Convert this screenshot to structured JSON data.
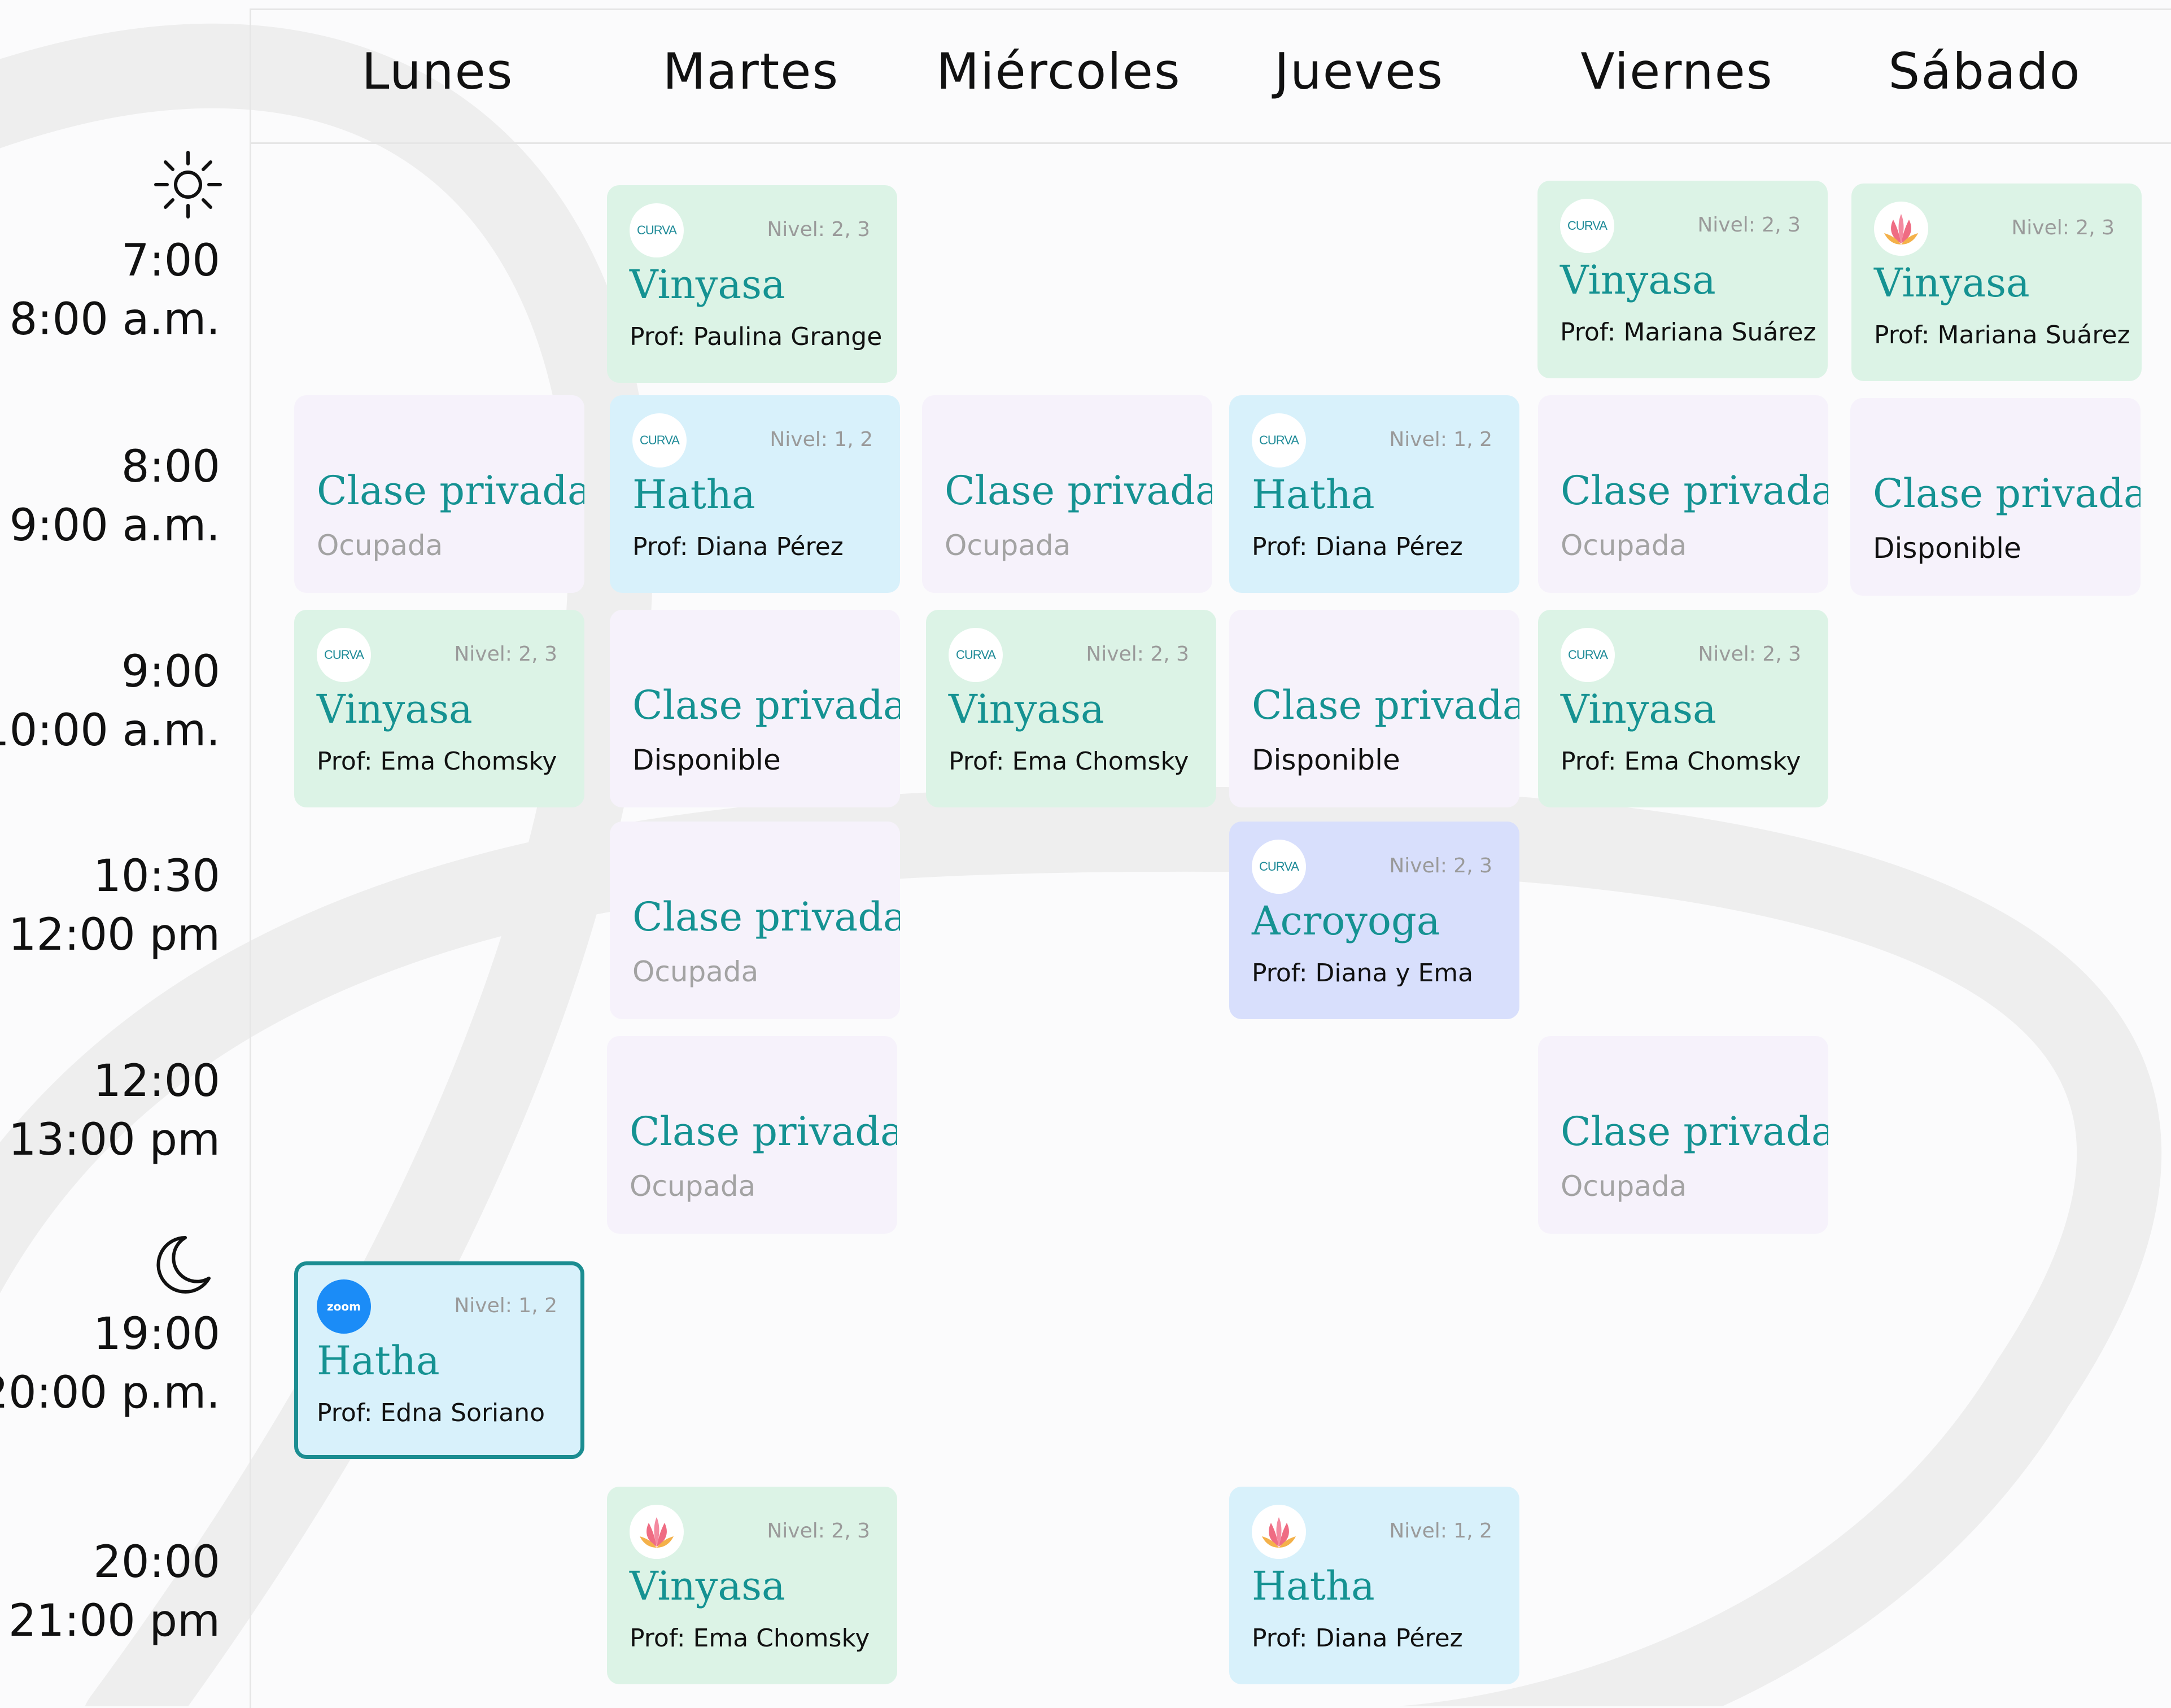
{
  "days": [
    "Lunes",
    "Martes",
    "Miércoles",
    "Jueves",
    "Viernes",
    "Sábado"
  ],
  "icons": {
    "morning": "sun-icon",
    "evening": "moon-icon"
  },
  "times": [
    {
      "start": "7:00",
      "end": "8:00 a.m."
    },
    {
      "start": "8:00",
      "end": "9:00 a.m."
    },
    {
      "start": "9:00",
      "end": "10:00 a.m."
    },
    {
      "start": "10:30",
      "end": "12:00 pm"
    },
    {
      "start": "12:00",
      "end": "13:00 pm"
    },
    {
      "start": "19:00",
      "end": "20:00 p.m."
    },
    {
      "start": "20:00",
      "end": "21:00 pm"
    }
  ],
  "cards": [
    {
      "day": "Martes",
      "slot": "7:00",
      "logo": "curva-logo",
      "level": "Nivel: 2, 3",
      "title": "Vinyasa",
      "prof": "Prof: Paulina Grange"
    },
    {
      "day": "Viernes",
      "slot": "7:00",
      "logo": "curva-logo",
      "level": "Nivel: 2, 3",
      "title": "Vinyasa",
      "prof": "Prof: Mariana Suárez"
    },
    {
      "day": "Sábado",
      "slot": "7:00",
      "logo": "lotus-logo",
      "level": "Nivel: 2, 3",
      "title": "Vinyasa",
      "prof": "Prof: Mariana Suárez"
    },
    {
      "day": "Lunes",
      "slot": "8:00",
      "title": "Clase privada",
      "status": "Ocupada"
    },
    {
      "day": "Martes",
      "slot": "8:00",
      "logo": "curva-logo",
      "level": "Nivel: 1, 2",
      "title": "Hatha",
      "prof": "Prof: Diana Pérez"
    },
    {
      "day": "Miércoles",
      "slot": "8:00",
      "title": "Clase privada",
      "status": "Ocupada"
    },
    {
      "day": "Jueves",
      "slot": "8:00",
      "logo": "curva-logo",
      "level": "Nivel: 1, 2",
      "title": "Hatha",
      "prof": "Prof: Diana Pérez"
    },
    {
      "day": "Viernes",
      "slot": "8:00",
      "title": "Clase privada",
      "status": "Ocupada"
    },
    {
      "day": "Sábado",
      "slot": "8:00",
      "title": "Clase privada",
      "status": "Disponible"
    },
    {
      "day": "Lunes",
      "slot": "9:00",
      "logo": "curva-logo",
      "level": "Nivel: 2, 3",
      "title": "Vinyasa",
      "prof": "Prof: Ema Chomsky"
    },
    {
      "day": "Martes",
      "slot": "9:00",
      "title": "Clase privada",
      "status": "Disponible"
    },
    {
      "day": "Miércoles",
      "slot": "9:00",
      "logo": "curva-logo",
      "level": "Nivel: 2, 3",
      "title": "Vinyasa",
      "prof": "Prof: Ema Chomsky"
    },
    {
      "day": "Jueves",
      "slot": "9:00",
      "title": "Clase privada",
      "status": "Disponible"
    },
    {
      "day": "Viernes",
      "slot": "9:00",
      "logo": "curva-logo",
      "level": "Nivel: 2, 3",
      "title": "Vinyasa",
      "prof": "Prof: Ema Chomsky"
    },
    {
      "day": "Martes",
      "slot": "10:30",
      "title": "Clase privada",
      "status": "Ocupada"
    },
    {
      "day": "Jueves",
      "slot": "10:30",
      "logo": "curva-logo",
      "level": "Nivel: 2, 3",
      "title": "Acroyoga",
      "prof": "Prof: Diana y Ema"
    },
    {
      "day": "Martes",
      "slot": "12:00",
      "title": "Clase privada",
      "status": "Ocupada"
    },
    {
      "day": "Viernes",
      "slot": "12:00",
      "title": "Clase privada",
      "status": "Ocupada"
    },
    {
      "day": "Lunes",
      "slot": "19:00",
      "logo": "zoom-logo",
      "level": "Nivel: 1, 2",
      "title": "Hatha",
      "prof": "Prof: Edna Soriano"
    },
    {
      "day": "Martes",
      "slot": "20:00",
      "logo": "lotus-logo",
      "level": "Nivel: 2, 3",
      "title": "Vinyasa",
      "prof": "Prof: Ema Chomsky"
    },
    {
      "day": "Jueves",
      "slot": "20:00",
      "logo": "lotus-logo",
      "level": "Nivel: 1, 2",
      "title": "Hatha",
      "prof": "Prof: Diana Pérez"
    }
  ],
  "logos": {
    "curva": "CURVA",
    "zoom": "zoom"
  },
  "colors": {
    "title_teal": "#159292",
    "vinyasa_green": "#dcf3e6",
    "hatha_blue": "#d8f1fb",
    "private_lilac": "#f6f2fb",
    "acroyoga_indigo": "#d8dffc",
    "selected_border": "#1b8d91",
    "zoom_blue": "#1b8cf7"
  }
}
